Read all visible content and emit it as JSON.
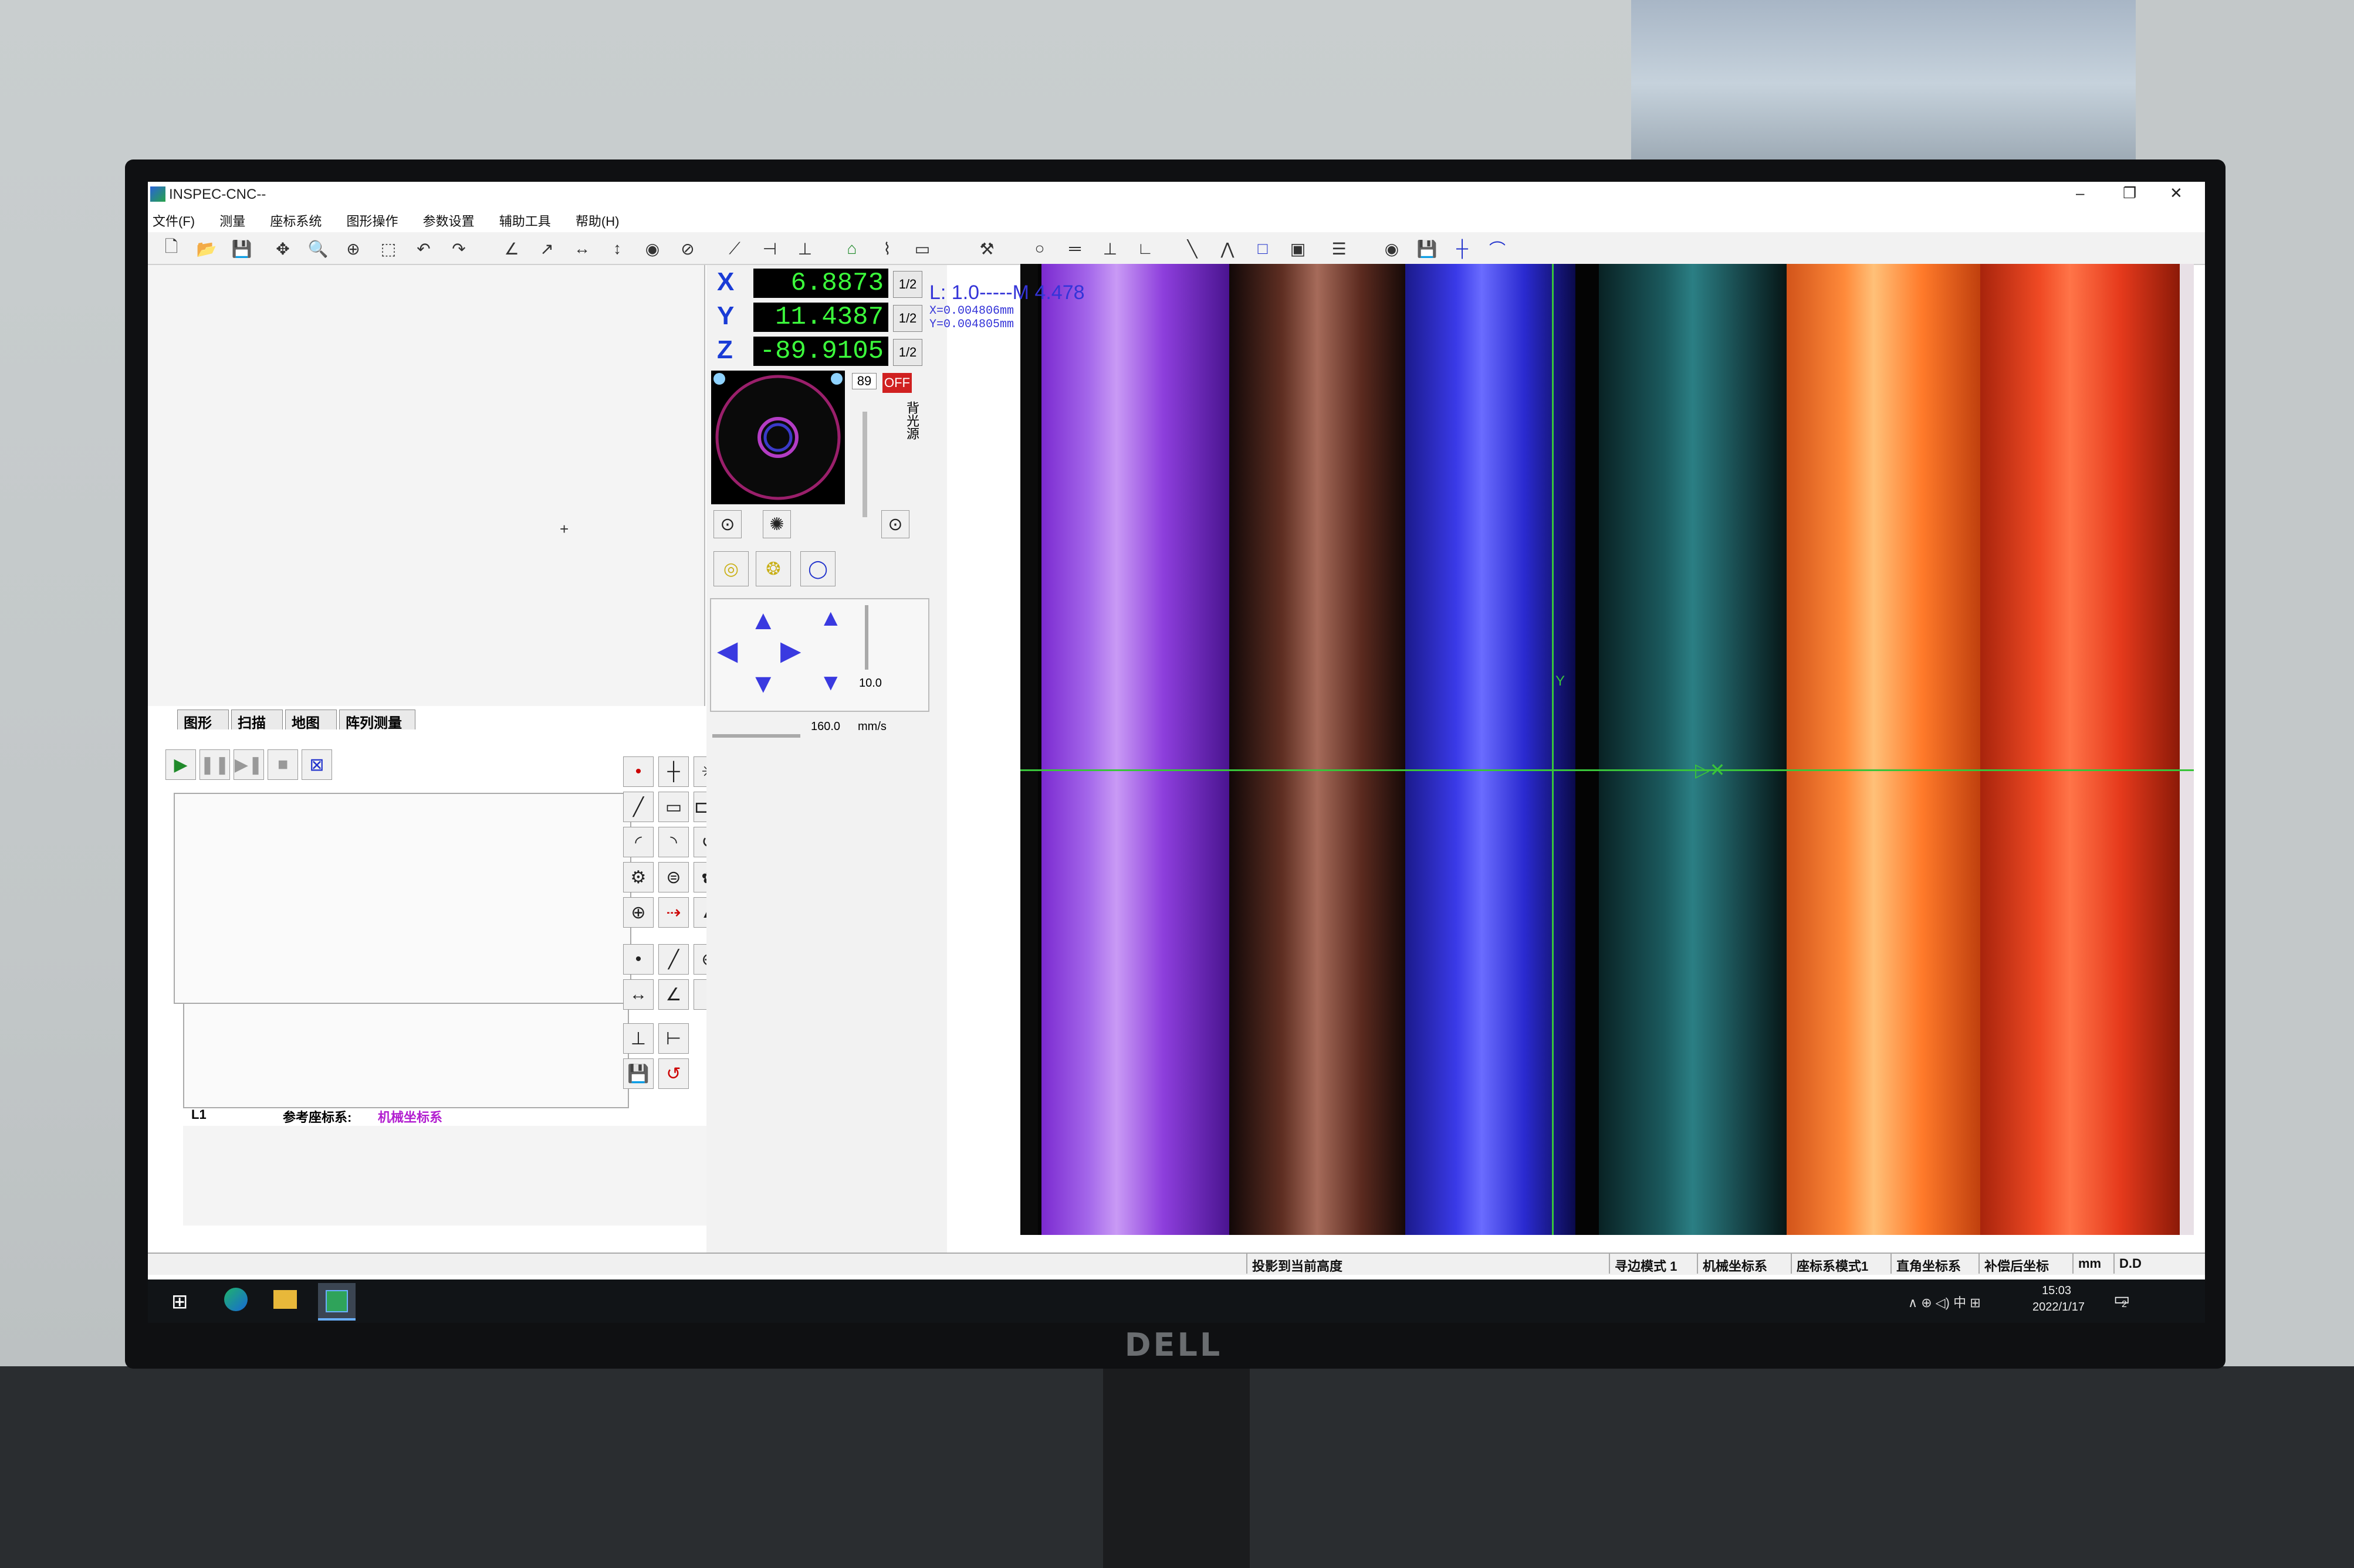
{
  "app": {
    "title": "INSPEC-CNC--",
    "window_controls": [
      "–",
      "❐",
      "✕"
    ]
  },
  "menu": [
    "文件(F)",
    "测量",
    "座标系统",
    "图形操作",
    "参数设置",
    "辅助工具",
    "帮助(H)"
  ],
  "dro": {
    "x_label": "X",
    "x_value": "6.8873",
    "x_half": "1/2",
    "y_label": "Y",
    "y_value": "11.4387",
    "y_half": "1/2",
    "z_label": "Z",
    "z_value": "-89.9105",
    "z_half": "1/2"
  },
  "light": {
    "value": "89",
    "off_label": "OFF",
    "vertical_label": "背光源"
  },
  "jog": {
    "small_value": "10.0",
    "speed_value": "160.0",
    "speed_unit": "mm/s"
  },
  "tabs": [
    "图形",
    "扫描",
    "地图",
    "阵列测量"
  ],
  "info_bar": {
    "left": "L1",
    "ref_label": "参考座标系:",
    "ref_value": "机械坐标系"
  },
  "camera_overlay": {
    "line1": "L: 1.0-----M 4.478",
    "line2": "X=0.004806mm",
    "line3": "Y=0.004805mm",
    "y_axis_label": "Y"
  },
  "status_bar": {
    "center": "投影到当前高度",
    "cells": [
      "寻边模式 1",
      "机械坐标系",
      "座标系模式1",
      "直角坐标系",
      "补偿后坐标",
      "mm",
      "D.D"
    ]
  },
  "taskbar": {
    "tray": "∧ ⊕ ◁) 中 ⊞",
    "time": "15:03",
    "date": "2022/1/17",
    "notif": "2"
  },
  "bezel": {
    "brand": "DELL"
  },
  "colors": {
    "accent_blue": "#1a3cd6",
    "readout_green": "#3cff3c",
    "crosshair": "#39c43a",
    "overlay_text": "#3434d8"
  }
}
